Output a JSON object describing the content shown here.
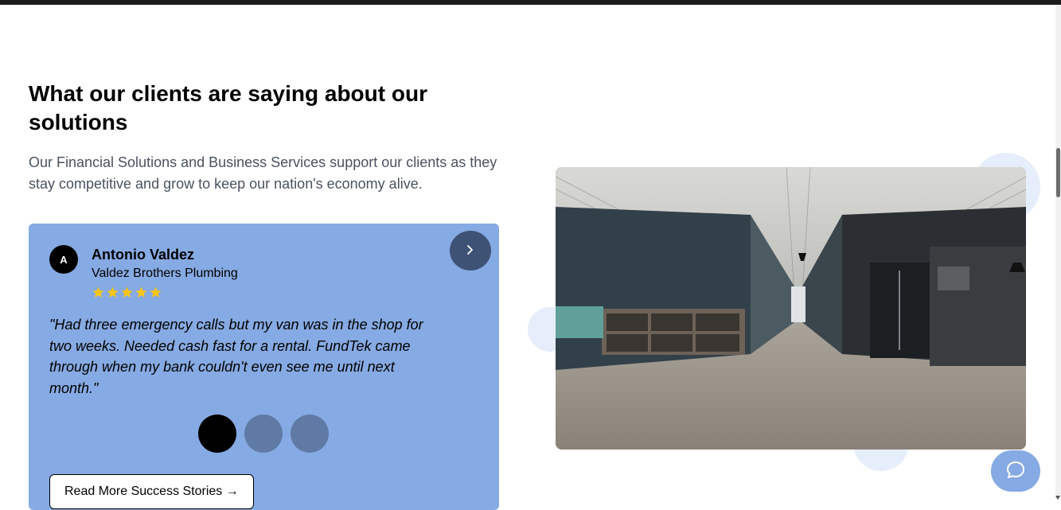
{
  "section": {
    "heading": "What our clients are saying about our solutions",
    "subtext": "Our Financial Solutions and Business Services support our clients as they stay competitive and grow to keep our nation's economy alive."
  },
  "testimonial": {
    "avatar_initial": "A",
    "name": "Antonio Valdez",
    "company": "Valdez Brothers Plumbing",
    "rating": 5,
    "quote": "\"Had three emergency calls but my van was in the shop for two weeks. Needed cash fast for a rental. FundTek came through when my bank couldn't even see me until next month.\"",
    "next_icon": "chevron-right-icon",
    "slides_total": 3,
    "active_slide": 1,
    "read_more_label": "Read More Success Stories →"
  },
  "image": {
    "subject": "office-interior-photo"
  },
  "chat": {
    "icon": "chat-bubble-icon"
  },
  "colors": {
    "card_bg": "#86aae3",
    "next_button": "#3e5276",
    "dot_inactive": "#5f7aa5",
    "dot_active": "#000000",
    "star": "#f5c518",
    "subtext": "#4a5260",
    "deco_circle": "#e6eefb"
  }
}
